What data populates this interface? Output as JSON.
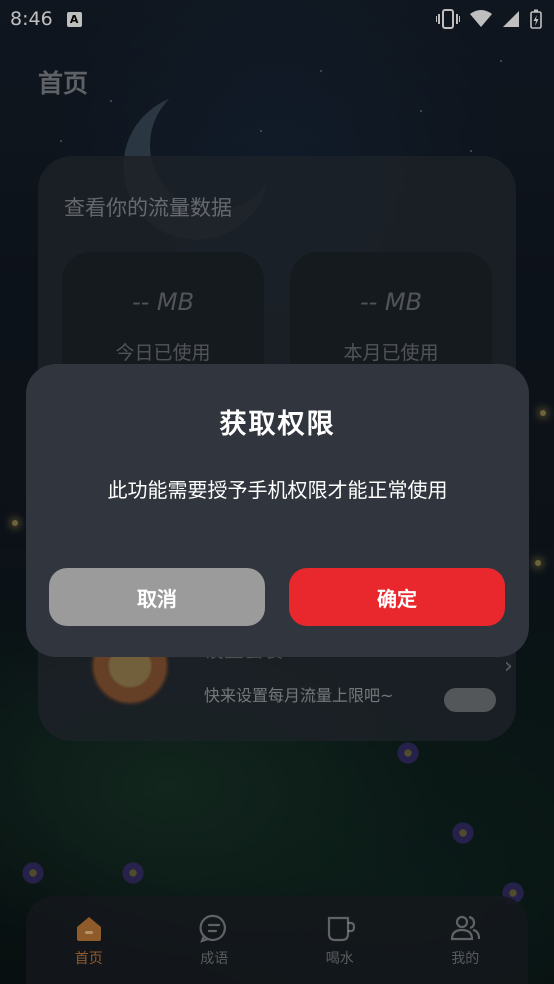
{
  "status_bar": {
    "time": "8:46",
    "left_icons": [
      "a-notification-icon"
    ],
    "right_icons": [
      "vibrate-icon",
      "wifi-icon",
      "signal-icon",
      "battery-icon"
    ]
  },
  "page": {
    "title": "首页"
  },
  "traffic_card": {
    "title": "查看你的流量数据",
    "today": {
      "value": "-- MB",
      "label": "今日已使用"
    },
    "month": {
      "value": "-- MB",
      "label": "本月已使用"
    }
  },
  "plan": {
    "title": "设置套餐",
    "description": "快来设置每月流量上限吧~",
    "chevron": "›"
  },
  "dialog": {
    "title": "获取权限",
    "message": "此功能需要授予手机权限才能正常使用",
    "cancel_label": "取消",
    "confirm_label": "确定"
  },
  "bottom_nav": {
    "items": [
      {
        "label": "首页",
        "icon": "home-icon",
        "active": true
      },
      {
        "label": "成语",
        "icon": "chat-icon",
        "active": false
      },
      {
        "label": "喝水",
        "icon": "cup-icon",
        "active": false
      },
      {
        "label": "我的",
        "icon": "users-icon",
        "active": false
      }
    ]
  },
  "colors": {
    "confirm": "#e8282d",
    "cancel": "#9b9b9b",
    "dialog_bg": "#31363e",
    "nav_active": "#c07a38"
  }
}
